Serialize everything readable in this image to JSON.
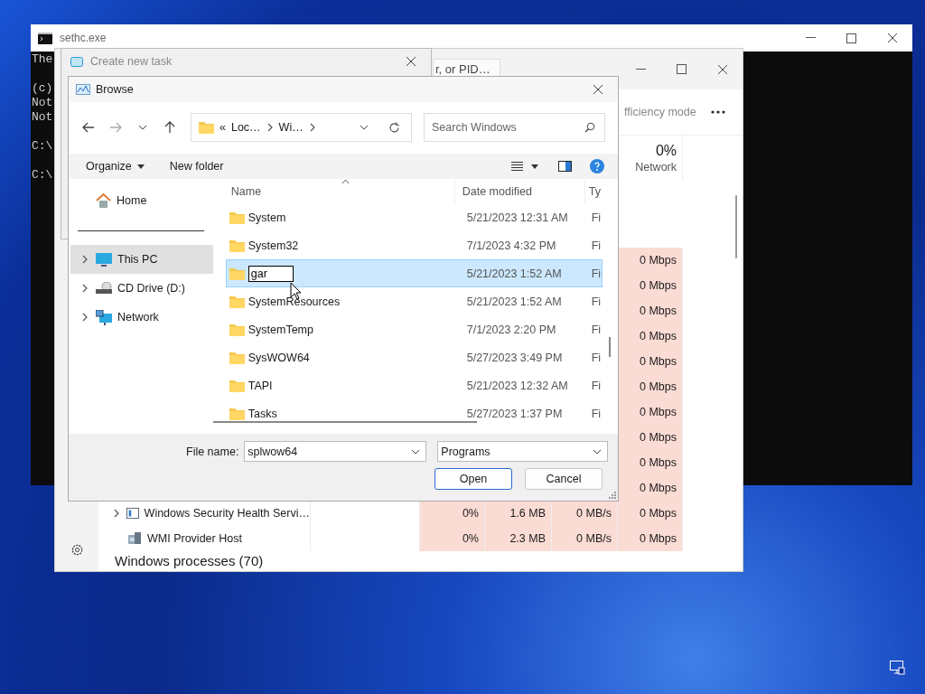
{
  "cmd_window": {
    "title": "sethc.exe",
    "paragraphs": [
      [
        "The"
      ],
      [
        "(c)",
        "Not",
        "Not"
      ],
      [
        "C:\\"
      ],
      [
        "C:\\"
      ]
    ]
  },
  "task_manager": {
    "search_placeholder": "r, or PID…",
    "toolbar_item": "fficiency mode",
    "network_header": {
      "percent": "0%",
      "label": "Network"
    },
    "rows": [
      {
        "network": "0 Mbps"
      },
      {
        "network": "0 Mbps"
      },
      {
        "network": "0 Mbps"
      },
      {
        "network": "0 Mbps"
      },
      {
        "network": "0 Mbps"
      },
      {
        "network": "0 Mbps"
      },
      {
        "network": "0 Mbps"
      },
      {
        "network": "0 Mbps"
      },
      {
        "network": "0 Mbps"
      },
      {
        "network": "0 Mbps"
      },
      {
        "name": "Windows Security Health Servi…",
        "expandable": true,
        "kind": "service",
        "cpu": "0%",
        "memory": "1.6 MB",
        "disk": "0 MB/s",
        "network": "0 Mbps"
      },
      {
        "name": "WMI Provider Host",
        "expandable": false,
        "kind": "host",
        "cpu": "0%",
        "memory": "2.3 MB",
        "disk": "0 MB/s",
        "network": "0 Mbps"
      }
    ],
    "group_heading": "Windows processes (70)"
  },
  "create_task_dialog": {
    "title": "Create new task"
  },
  "browse_dialog": {
    "title": "Browse",
    "address": {
      "overflow_glyph": "«",
      "crumbs": [
        "Loc…",
        "Wi…"
      ]
    },
    "search_placeholder": "Search Windows",
    "toolbar": {
      "organize": "Organize",
      "new_folder": "New folder"
    },
    "nav": [
      {
        "label": "Home",
        "kind": "home",
        "expandable": false,
        "selected": false
      },
      {
        "label": "This PC",
        "kind": "pc",
        "expandable": true,
        "selected": true
      },
      {
        "label": "CD Drive (D:)",
        "kind": "cd-drive",
        "expandable": true,
        "selected": false
      },
      {
        "label": "Network",
        "kind": "network",
        "expandable": true,
        "selected": false
      }
    ],
    "columns": [
      "Name",
      "Date modified",
      "Ty"
    ],
    "files": [
      {
        "name": "System",
        "date": "5/21/2023 12:31 AM",
        "type": "Fi",
        "selected": false,
        "renaming": false
      },
      {
        "name": "System32",
        "date": "7/1/2023 4:32 PM",
        "type": "Fi",
        "selected": false,
        "renaming": false
      },
      {
        "name": "gar",
        "date": "5/21/2023 1:52 AM",
        "type": "Fi",
        "selected": true,
        "renaming": true
      },
      {
        "name": "SystemResources",
        "date": "5/21/2023 1:52 AM",
        "type": "Fi",
        "selected": false,
        "renaming": false
      },
      {
        "name": "SystemTemp",
        "date": "7/1/2023 2:20 PM",
        "type": "Fi",
        "selected": false,
        "renaming": false
      },
      {
        "name": "SysWOW64",
        "date": "5/27/2023 3:49 PM",
        "type": "Fi",
        "selected": false,
        "renaming": false
      },
      {
        "name": "TAPI",
        "date": "5/21/2023 12:32 AM",
        "type": "Fi",
        "selected": false,
        "renaming": false
      },
      {
        "name": "Tasks",
        "date": "5/27/2023 1:37 PM",
        "type": "Fi",
        "selected": false,
        "renaming": false
      }
    ],
    "file_name_label": "File name:",
    "file_name": "splwow64",
    "file_type": "Programs",
    "buttons": [
      {
        "label": "Open",
        "default": true
      },
      {
        "label": "Cancel",
        "default": false
      }
    ]
  }
}
